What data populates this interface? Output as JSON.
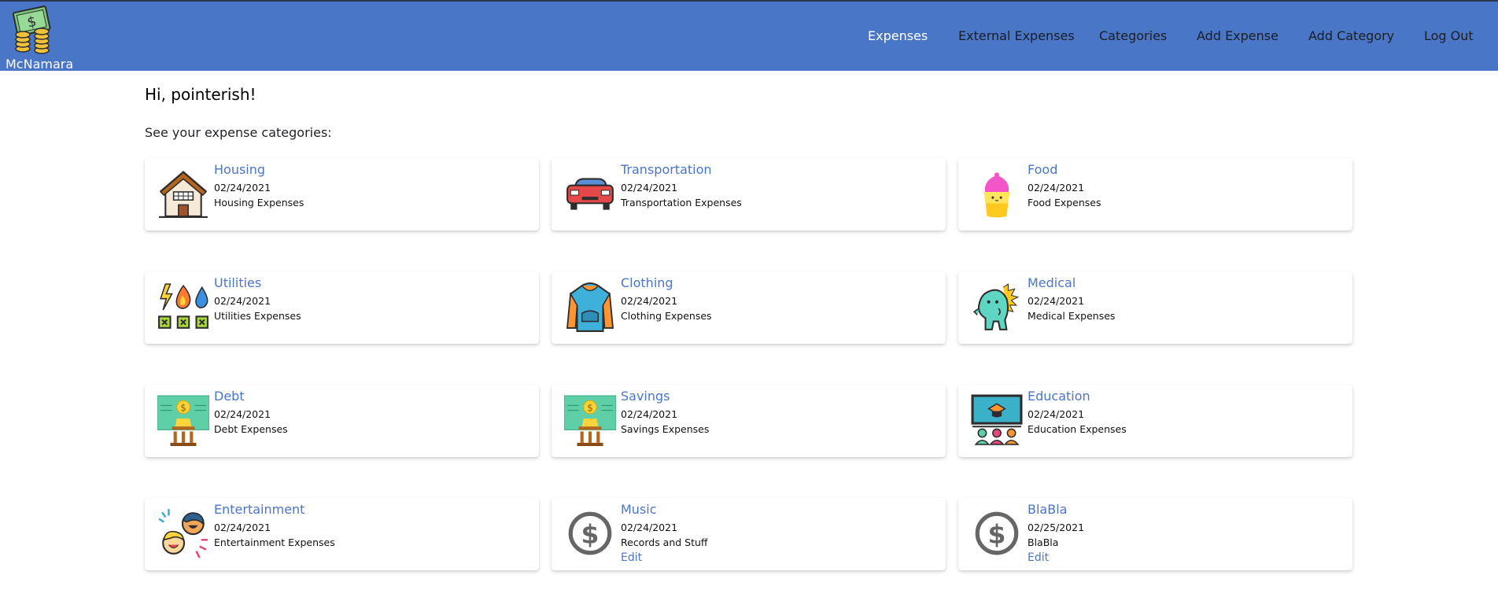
{
  "brand": {
    "name": "McNamara",
    "icon": "money-coins-icon"
  },
  "nav": {
    "links": [
      {
        "label": "Expenses",
        "active": true
      },
      {
        "label": "External Expenses"
      },
      {
        "label": "Categories"
      },
      {
        "label": "Add Expense"
      },
      {
        "label": "Add Category"
      },
      {
        "label": "Log Out"
      }
    ]
  },
  "greeting": "Hi, pointerish!",
  "subtitle": "See your expense categories:",
  "colors": {
    "navbar": "#4a76c7",
    "link": "#4a76c7",
    "nav_active": "#ffffff"
  },
  "categories": [
    {
      "title": "Housing",
      "date": "02/24/2021",
      "description": "Housing Expenses",
      "icon": "house-icon"
    },
    {
      "title": "Transportation",
      "date": "02/24/2021",
      "description": "Transportation Expenses",
      "icon": "car-icon"
    },
    {
      "title": "Food",
      "date": "02/24/2021",
      "description": "Food Expenses",
      "icon": "cupcake-icon"
    },
    {
      "title": "Utilities",
      "date": "02/24/2021",
      "description": "Utilities Expenses",
      "icon": "utilities-icon"
    },
    {
      "title": "Clothing",
      "date": "02/24/2021",
      "description": "Clothing Expenses",
      "icon": "hoodie-icon"
    },
    {
      "title": "Medical",
      "date": "02/24/2021",
      "description": "Medical Expenses",
      "icon": "dinosaur-icon"
    },
    {
      "title": "Debt",
      "date": "02/24/2021",
      "description": "Debt Expenses",
      "icon": "bank-money-icon"
    },
    {
      "title": "Savings",
      "date": "02/24/2021",
      "description": "Savings Expenses",
      "icon": "bank-money-icon"
    },
    {
      "title": "Education",
      "date": "02/24/2021",
      "description": "Education Expenses",
      "icon": "classroom-icon"
    },
    {
      "title": "Entertainment",
      "date": "02/24/2021",
      "description": "Entertainment Expenses",
      "icon": "people-laughing-icon"
    },
    {
      "title": "Music",
      "date": "02/24/2021",
      "description": "Records and Stuff",
      "icon": "dollar-circle-icon",
      "edit": "Edit"
    },
    {
      "title": "BlaBla",
      "date": "02/25/2021",
      "description": "BlaBla",
      "icon": "dollar-circle-icon",
      "edit": "Edit"
    }
  ]
}
